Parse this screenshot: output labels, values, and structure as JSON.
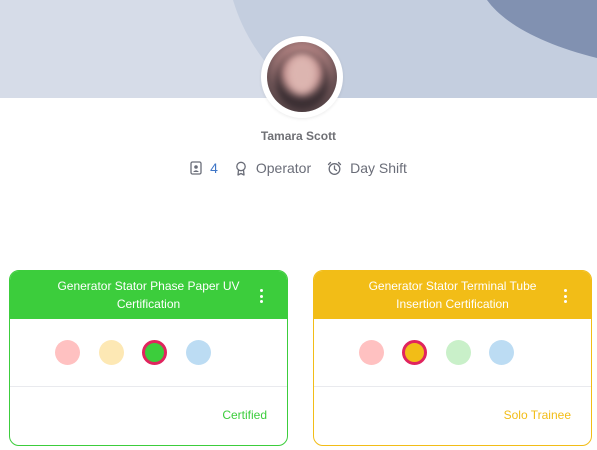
{
  "profile": {
    "name": "Tamara Scott",
    "count": "4",
    "role": "Operator",
    "shift": "Day Shift"
  },
  "colors": {
    "green": "#3ccd3c",
    "yellow": "#f2bd17",
    "selected_border": "#e0245e",
    "level_1": "#ffc1c1",
    "level_2": "#fde8b4",
    "level_3": "#c9f0c9",
    "level_4": "#bcdcf3"
  },
  "icons": {
    "count": "badge-icon",
    "role": "award-icon",
    "shift": "alarm-clock-icon",
    "card_menu": "kebab-menu-icon"
  },
  "cards": [
    {
      "title": "Generator Stator Phase Paper UV Certification",
      "status": "Certified",
      "selected_level": 3
    },
    {
      "title": "Generator Stator Terminal Tube Insertion Certification",
      "status": "Solo Trainee",
      "selected_level": 2
    }
  ]
}
